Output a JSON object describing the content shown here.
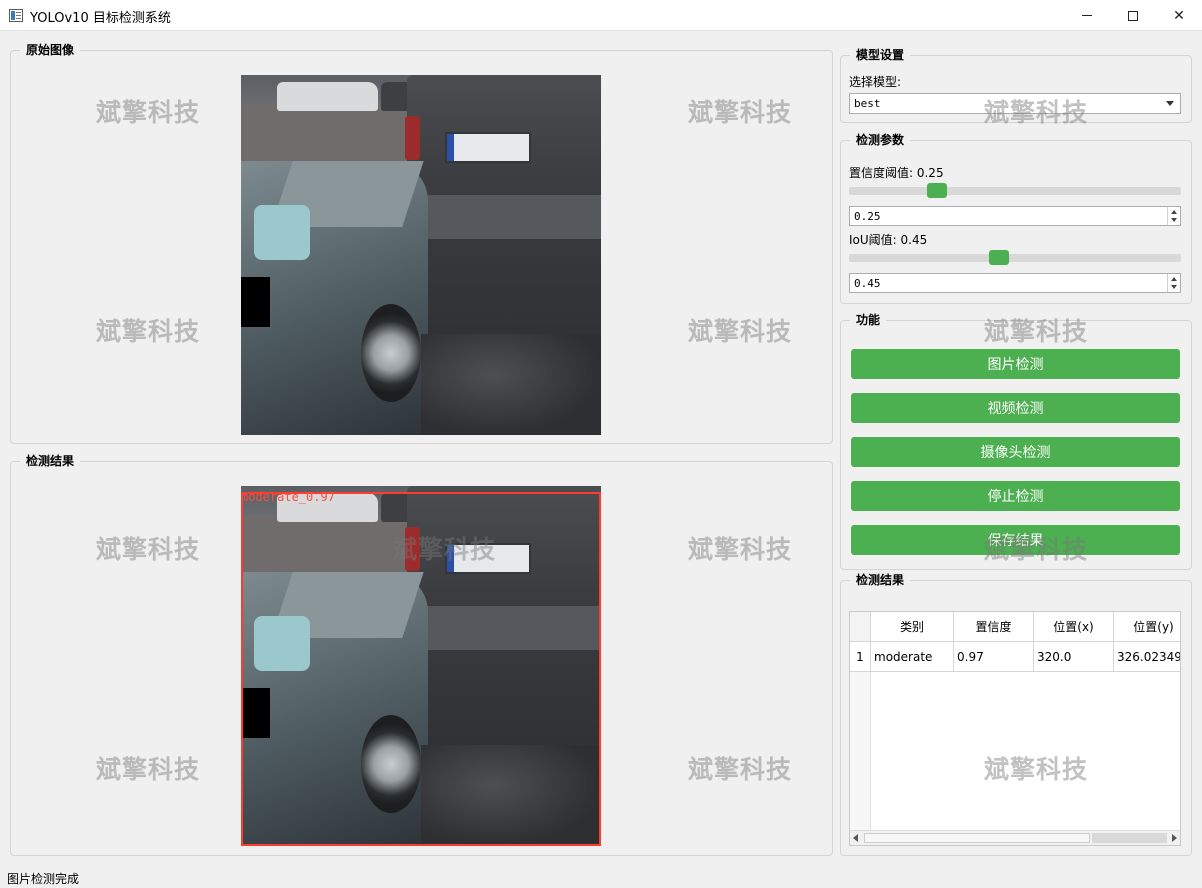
{
  "window": {
    "title": "YOLOv10 目标检测系统"
  },
  "watermark_text": "斌擎科技",
  "original_panel": {
    "title": "原始图像"
  },
  "result_panel": {
    "title": "检测结果",
    "detection_label": "moderate_0.97"
  },
  "model_settings": {
    "title": "模型设置",
    "select_label": "选择模型:",
    "selected_model": "best"
  },
  "detection_params": {
    "title": "检测参数",
    "confidence_label": "置信度阈值: 0.25",
    "confidence_value": "0.25",
    "confidence_level": 0.25,
    "iou_label": "IoU阈值: 0.45",
    "iou_value": "0.45",
    "iou_level": 0.45
  },
  "functions": {
    "title": "功能",
    "buttons": [
      "图片检测",
      "视频检测",
      "摄像头检测",
      "停止检测",
      "保存结果"
    ]
  },
  "results_table": {
    "title": "检测结果",
    "headers": [
      "类别",
      "置信度",
      "位置(x)",
      "位置(y)"
    ],
    "rows": [
      {
        "index": "1",
        "class": "moderate",
        "confidence": "0.97",
        "x": "320.0",
        "y": "326.02349..."
      }
    ]
  },
  "status_bar": {
    "text": "图片检测完成"
  },
  "colors": {
    "accent_green": "#4caf50",
    "detection_box": "#ff3b30"
  }
}
